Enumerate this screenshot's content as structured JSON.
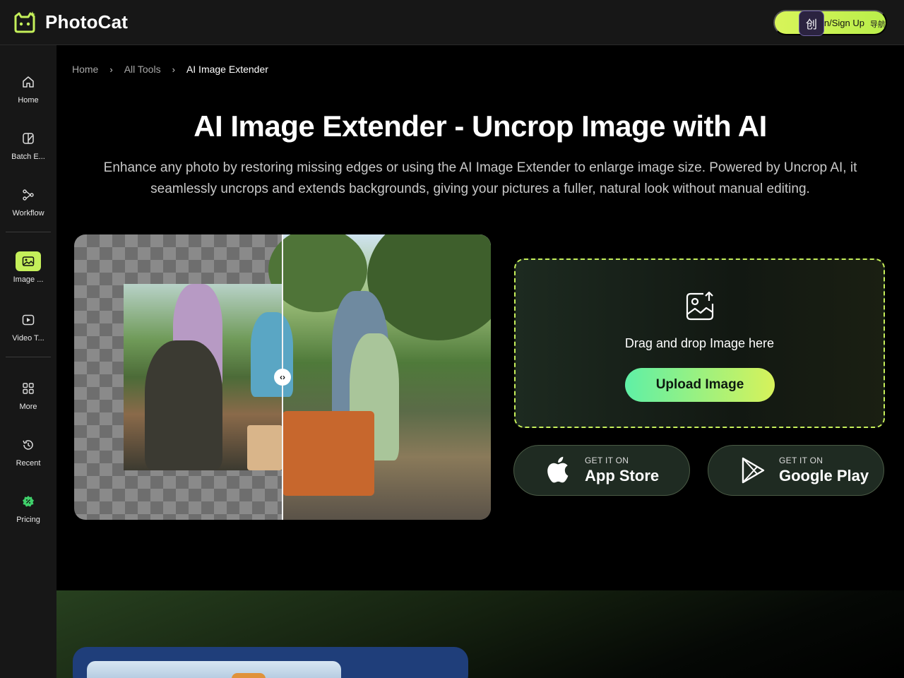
{
  "app": {
    "name": "PhotoCat",
    "login_label": "Log In/Sign Up",
    "badge_glyph": "创",
    "nav_tag": "导航"
  },
  "sidebar": {
    "items": [
      {
        "label": "Home",
        "icon": "home-icon"
      },
      {
        "label": "Batch E...",
        "icon": "batch-edit-icon"
      },
      {
        "label": "Workflow",
        "icon": "workflow-icon"
      },
      {
        "label": "Image ...",
        "icon": "image-icon",
        "active": true
      },
      {
        "label": "Video T...",
        "icon": "video-icon"
      },
      {
        "label": "More",
        "icon": "grid-icon"
      },
      {
        "label": "Recent",
        "icon": "history-icon"
      },
      {
        "label": "Pricing",
        "icon": "pricing-icon"
      }
    ]
  },
  "breadcrumb": {
    "items": [
      "Home",
      "All Tools",
      "AI Image Extender"
    ]
  },
  "hero": {
    "title": "AI Image Extender - Uncrop Image with AI",
    "description": "Enhance any photo by restoring missing edges or using the AI Image Extender to enlarge image size. Powered by Uncrop AI, it seamlessly uncrops and extends backgrounds, giving your pictures a fuller, natural look without manual editing."
  },
  "compare": {
    "handle_glyph": "‹›"
  },
  "upload": {
    "prompt": "Drag and drop Image here",
    "button_label": "Upload Image"
  },
  "stores": [
    {
      "small": "GET IT ON",
      "big": "App Store",
      "icon": "apple-icon"
    },
    {
      "small": "GET IT ON",
      "big": "Google Play",
      "icon": "google-play-icon"
    }
  ],
  "colors": {
    "accent": "#c4ef5a",
    "accent_gradient_start": "#5ff0a6",
    "sidebar_bg": "#171717",
    "page_bg": "#000000"
  }
}
